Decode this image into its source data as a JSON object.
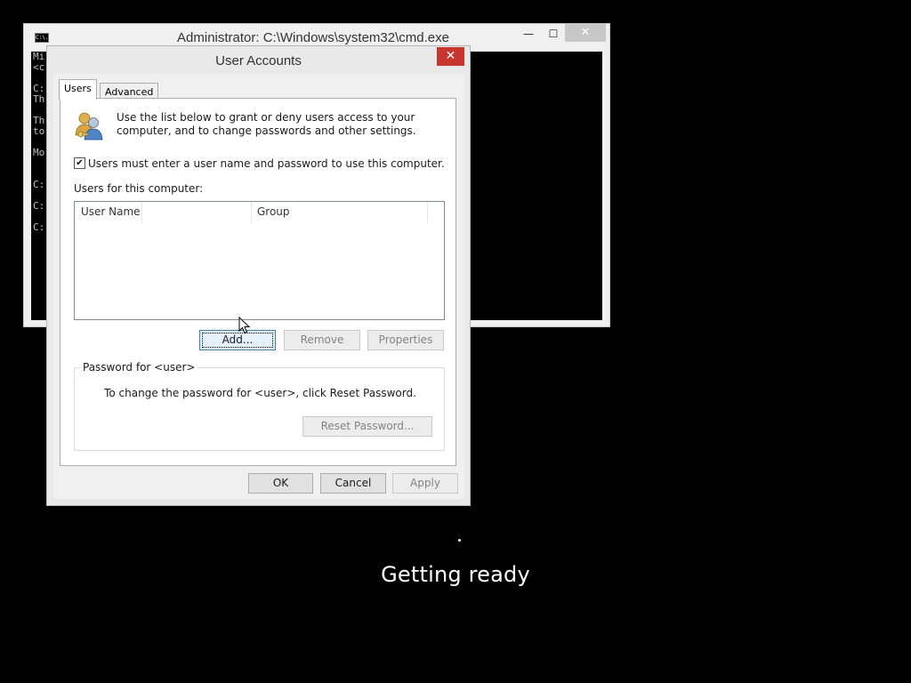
{
  "cmd_window": {
    "title": "Administrator: C:\\Windows\\system32\\cmd.exe",
    "icon_text": "C:\\.",
    "minimize": "—",
    "maximize": "☐",
    "close": "✕",
    "console_lines": "Mi\n<c\n\nC:\nTh\n\nTh\nto\n\nMo\n\n\nC:\n\nC:\n\nC:"
  },
  "user_accounts": {
    "title": "User Accounts",
    "close": "✕",
    "tabs": [
      {
        "label": "Users",
        "selected": true
      },
      {
        "label": "Advanced",
        "selected": false
      }
    ],
    "intro_text": "Use the list below to grant or deny users access to your computer, and to change passwords and other settings.",
    "must_enter_label": "Users must enter a user name and password to use this computer.",
    "must_enter_checked": true,
    "users_label": "Users for this computer:",
    "columns": [
      "User Name",
      "Group"
    ],
    "rows": [],
    "buttons": {
      "add": "Add...",
      "remove": "Remove",
      "properties": "Properties"
    },
    "password_group": {
      "legend": "Password for <user>",
      "text": "To change the password for <user>, click Reset Password.",
      "reset_button": "Reset Password..."
    },
    "footer": {
      "ok": "OK",
      "cancel": "Cancel",
      "apply": "Apply"
    }
  },
  "status": {
    "getting_ready": "Getting ready"
  },
  "icons": {
    "dialog_icon": "users-icon",
    "cursor": "mouse-pointer-icon"
  },
  "colors": {
    "close_red": "#c7372f",
    "focus_blue": "#3c7fb1",
    "background": "#000000"
  }
}
